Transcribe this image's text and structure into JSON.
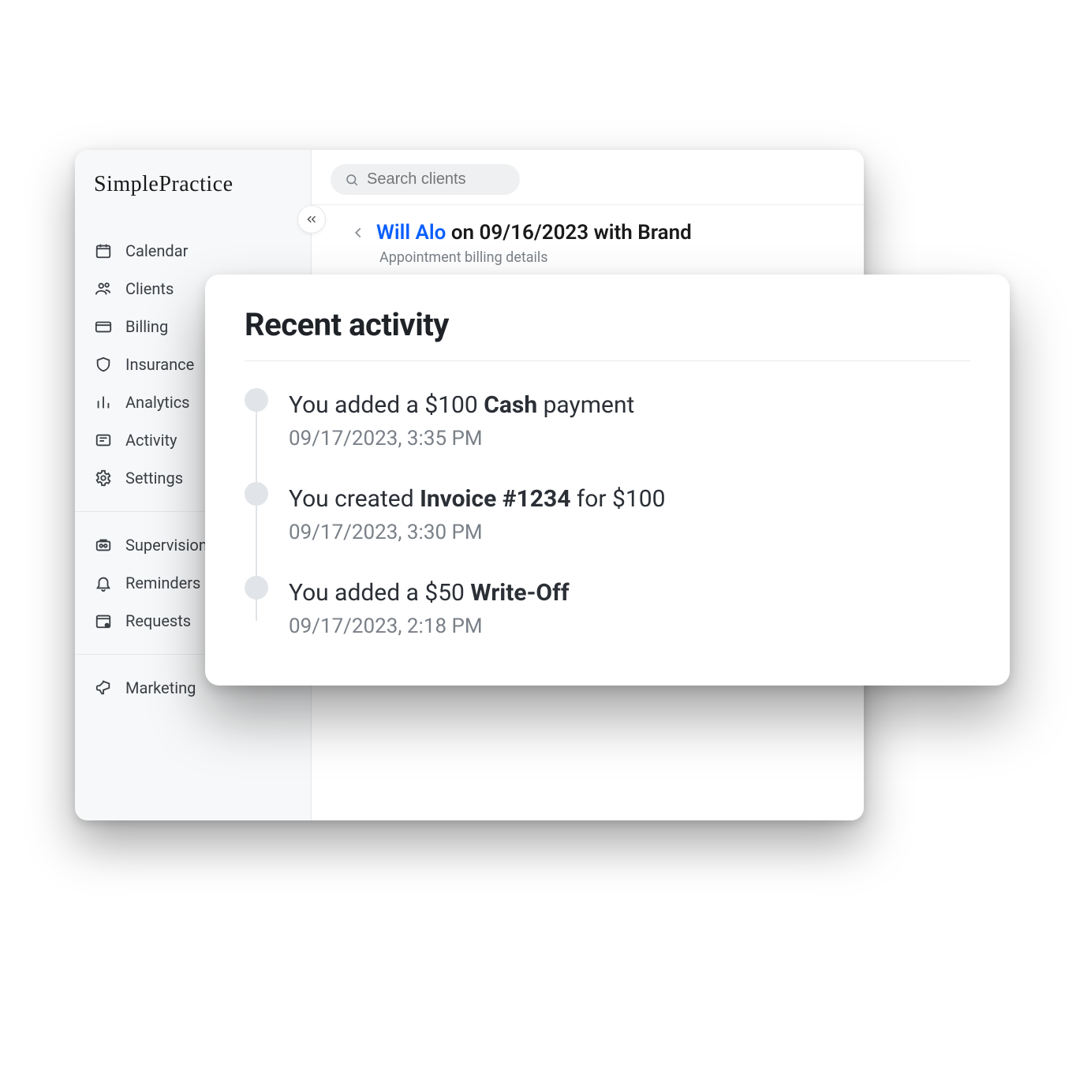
{
  "app": {
    "logo": "SimplePractice"
  },
  "sidebar": {
    "primary": [
      {
        "id": "calendar",
        "label": "Calendar"
      },
      {
        "id": "clients",
        "label": "Clients"
      },
      {
        "id": "billing",
        "label": "Billing"
      },
      {
        "id": "insurance",
        "label": "Insurance"
      },
      {
        "id": "analytics",
        "label": "Analytics"
      },
      {
        "id": "activity",
        "label": "Activity"
      },
      {
        "id": "settings",
        "label": "Settings"
      }
    ],
    "secondary": [
      {
        "id": "supervision",
        "label": "Supervision"
      },
      {
        "id": "reminders",
        "label": "Reminders"
      },
      {
        "id": "requests",
        "label": "Requests"
      }
    ],
    "tertiary": [
      {
        "id": "marketing",
        "label": "Marketing"
      }
    ]
  },
  "search": {
    "placeholder": "Search clients"
  },
  "breadcrumb": {
    "client": "Will Alo",
    "rest": " on 09/16/2023 with Brand",
    "subtitle": "Appointment billing details"
  },
  "recent_activity": {
    "heading": "Recent activity",
    "items": [
      {
        "pre": "You added a $100 ",
        "bold": "Cash",
        "post": " payment",
        "ts": "09/17/2023, 3:35 PM"
      },
      {
        "pre": "You created ",
        "bold": "Invoice #1234",
        "post": " for $100",
        "ts": "09/17/2023, 3:30 PM"
      },
      {
        "pre": "You added a $50 ",
        "bold": "Write-Off",
        "post": "",
        "ts": "09/17/2023, 2:18 PM"
      }
    ]
  }
}
